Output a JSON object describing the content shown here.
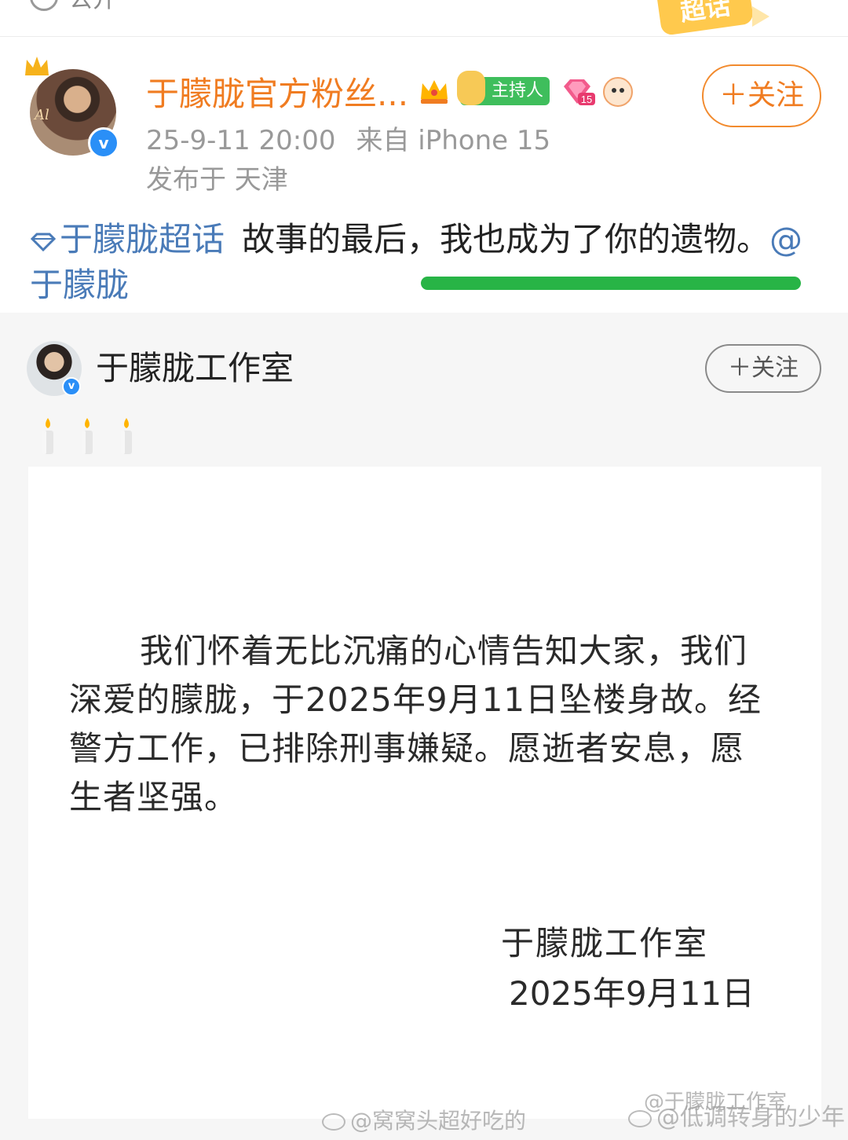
{
  "top_strip": {
    "visibility_label": "公开",
    "chaohua_badge": "超话"
  },
  "post": {
    "author": "于朦胧官方粉丝...",
    "badges": [
      "crown-badge",
      "host-badge",
      "level-badge",
      "fan-face-badge"
    ],
    "host_badge_label": "主持人",
    "level_badge_number": "15",
    "follow_label": "＋关注",
    "time": "25-9-11 20:00",
    "source": "来自 iPhone 15",
    "location": "发布于 天津",
    "topic": "于朦胧超话",
    "text": "故事的最后，我也成为了你的遗物。",
    "mention": "@于朦胧",
    "colors": {
      "author": "#f07c21",
      "link": "#4a7bb8",
      "highlight": "#28b446"
    }
  },
  "repost": {
    "author": "于朦胧工作室",
    "follow_label": "＋关注",
    "candles": [
      "candle",
      "candle",
      "candle"
    ],
    "statement_body": "我们怀着无比沉痛的心情告知大家，我们深爱的朦胧，于2025年9月11日坠楼身故。经警方工作，已排除刑事嫌疑。愿逝者安息，愿生者坚强。",
    "signature_name": "于朦胧工作室",
    "signature_date": "2025年9月11日"
  },
  "watermarks": {
    "wm1": "@窝窝头超好吃的",
    "wm2": "@于朦胧工作室",
    "wm3": "@低调转身的少年"
  }
}
